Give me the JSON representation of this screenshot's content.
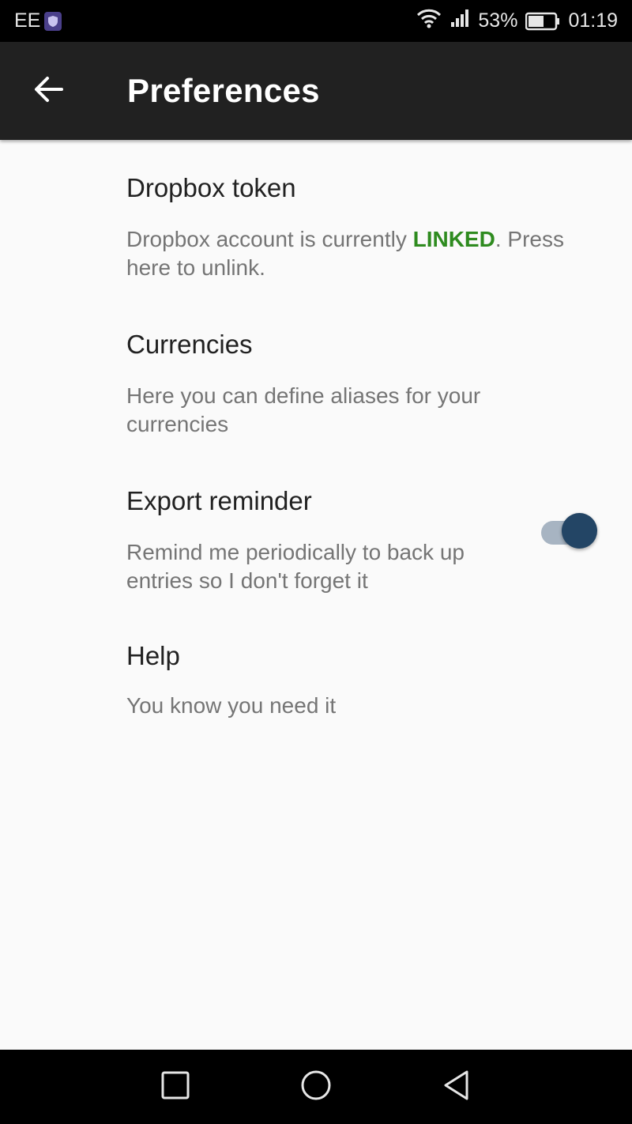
{
  "status_bar": {
    "carrier": "EE",
    "battery_percent": "53%",
    "time": "01:19"
  },
  "app_bar": {
    "title": "Preferences",
    "back_icon": "arrow-left-icon"
  },
  "preferences": [
    {
      "title": "Dropbox token",
      "summary_before": "Dropbox account is currently ",
      "summary_highlight": "LINKED",
      "summary_after": ". Press here to unlink."
    },
    {
      "title": "Currencies",
      "summary": "Here you can define aliases for your currencies"
    },
    {
      "title": "Export reminder",
      "summary": "Remind me periodically to back up entries so I don't forget it",
      "toggle_on": true
    },
    {
      "title": "Help",
      "summary": "You know you need it"
    }
  ],
  "colors": {
    "app_bar": "#212121",
    "linked": "#2e8b1f",
    "toggle_thumb": "#234565",
    "toggle_track": "#a7b4c2"
  },
  "nav_bar": {
    "icons": [
      "recents-square-icon",
      "home-circle-icon",
      "back-triangle-icon"
    ]
  }
}
